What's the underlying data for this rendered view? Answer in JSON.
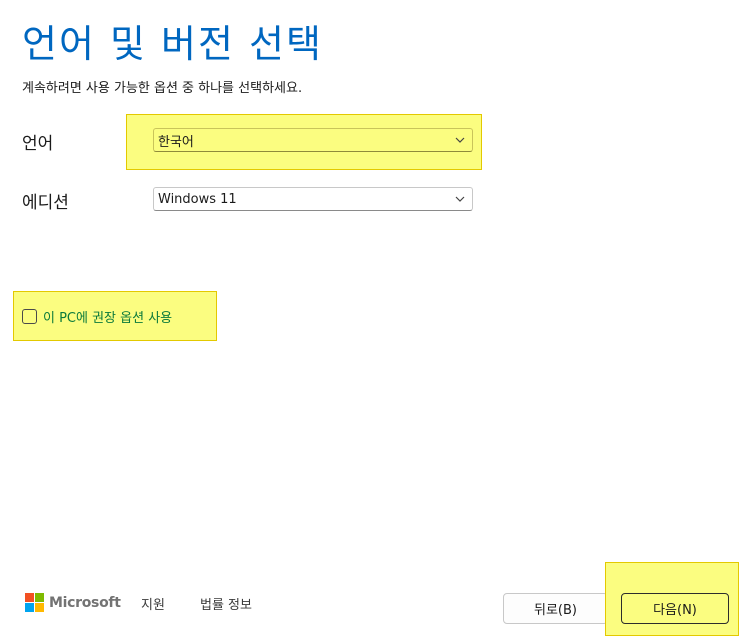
{
  "header": {
    "title": "언어 및 버전 선택",
    "subtitle": "계속하려면 사용 가능한 옵션 중 하나를 선택하세요."
  },
  "language": {
    "label": "언어",
    "value": "한국어",
    "icon": "chevron-down-icon"
  },
  "edition": {
    "label": "에디션",
    "value": "Windows 11",
    "icon": "chevron-down-icon"
  },
  "recommended": {
    "label": "이 PC에 권장 옵션 사용",
    "checked": false
  },
  "footer": {
    "brand": "Microsoft",
    "support": "지원",
    "legal": "법률 정보"
  },
  "buttons": {
    "back": "뒤로(B)",
    "next": "다음(N)"
  },
  "colors": {
    "title": "#0067c0",
    "highlight": "#fbfd80",
    "checkbox_label": "#0b7a3b",
    "logo_red": "#f25022",
    "logo_green": "#7fba00",
    "logo_blue": "#00a4ef",
    "logo_yellow": "#ffb900"
  }
}
